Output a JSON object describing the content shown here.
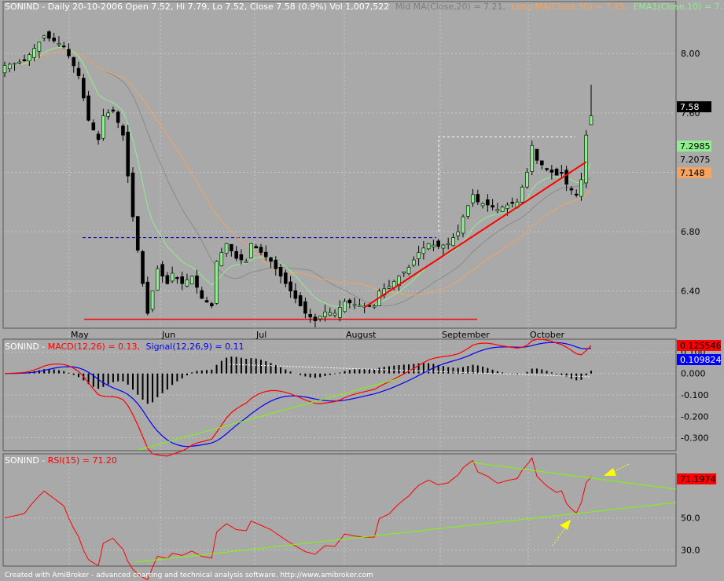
{
  "header": {
    "symbol": "SONIND",
    "info": " - Daily 20-10-2006 Open 7.52, Hi 7.79, Lo 7.52, Close 7.58 (0.9%) Vol 1,007,522",
    "mid_ma": "Mid MA(Close,20) = 7.21,",
    "long_ma": "Long MA(Close,30) = 7.15,",
    "ema": "EMA1(Close,10) = 7.30"
  },
  "months": [
    "May",
    "Jun",
    "Jul",
    "August",
    "September",
    "October"
  ],
  "price_axis": {
    "ticks": [
      "8.00",
      "7.60",
      "7.20",
      "6.80",
      "6.40"
    ]
  },
  "price_tags": [
    {
      "label": "7.58",
      "bg": "#000000",
      "fg": "#ffffff"
    },
    {
      "label": "7.2985",
      "bg": "#90ee90",
      "fg": "#000000"
    },
    {
      "label": "7.2075",
      "bg": "#a9a9a9",
      "fg": "#000000"
    },
    {
      "label": "7.148",
      "bg": "#f4a460",
      "fg": "#000000"
    }
  ],
  "macd_header": {
    "symbol": "SONIND",
    "macd": "MACD(12,26) = 0.13,",
    "signal": "Signal(12,26,9) = 0.11"
  },
  "macd_axis": {
    "ticks": [
      "0.100",
      "0.000",
      "-0.100",
      "-0.200",
      "-0.300"
    ]
  },
  "macd_tags": [
    {
      "label": "0.125546",
      "bg": "#ff0000",
      "fg": "#000000"
    },
    {
      "label": "0.109824",
      "bg": "#0000ff",
      "fg": "#ffffff"
    }
  ],
  "rsi_header": {
    "symbol": "SONIND",
    "rsi": "RSI(15) = 71.20"
  },
  "rsi_axis": {
    "ticks": [
      "50.0",
      "30.0"
    ]
  },
  "rsi_tag": {
    "label": "71.1974",
    "bg": "#ff0000",
    "fg": "#000000"
  },
  "footer": "Created with AmiBroker - advanced charting and technical analysis software. http://www.amibroker.com",
  "colors": {
    "background": "#a9a9a9",
    "bull_candle": "#90ee90",
    "bear_candle": "#000000",
    "mid_ma": "#8a8a8a",
    "long_ma": "#f4a460",
    "ema": "#90ee90",
    "macd": "#ff0000",
    "signal": "#0000ff",
    "rsi": "#ff0000",
    "trendline": "#ff0000",
    "support_line": "#7cfc00",
    "arrow": "#ffff00"
  },
  "chart_data": [
    {
      "type": "candlestick",
      "title": "SONIND - Daily 20-10-2006",
      "ylim": [
        6.15,
        8.35
      ],
      "series": [
        {
          "name": "Price",
          "x": [],
          "y": []
        },
        {
          "name": "Mid MA(Close,20)",
          "last": 7.21
        },
        {
          "name": "Long MA(Close,30)",
          "last": 7.15
        },
        {
          "name": "EMA1(Close,10)",
          "last": 7.3
        }
      ],
      "last": {
        "open": 7.52,
        "high": 7.79,
        "low": 7.52,
        "close": 7.58,
        "change_pct": 0.9,
        "volume": 1007522
      },
      "annotations": [
        {
          "type": "hline",
          "value": 6.76,
          "style": "dashed",
          "color": "#0000aa"
        },
        {
          "type": "hline",
          "value": 6.21,
          "style": "solid",
          "color": "#ff0000"
        },
        {
          "type": "trendline",
          "from": 6.29,
          "to": 7.27,
          "color": "#ff0000"
        }
      ],
      "grid": true
    },
    {
      "type": "line",
      "title": "MACD(12,26), Signal(12,26,9)",
      "ylim": [
        -0.36,
        0.16
      ],
      "series": [
        {
          "name": "MACD(12,26)",
          "last": 0.13
        },
        {
          "name": "Signal(12,26,9)",
          "last": 0.11
        }
      ],
      "grid": true
    },
    {
      "type": "line",
      "title": "RSI(15)",
      "ylim": [
        20,
        90
      ],
      "series": [
        {
          "name": "RSI(15)",
          "last": 71.2
        }
      ],
      "grid": true
    }
  ]
}
